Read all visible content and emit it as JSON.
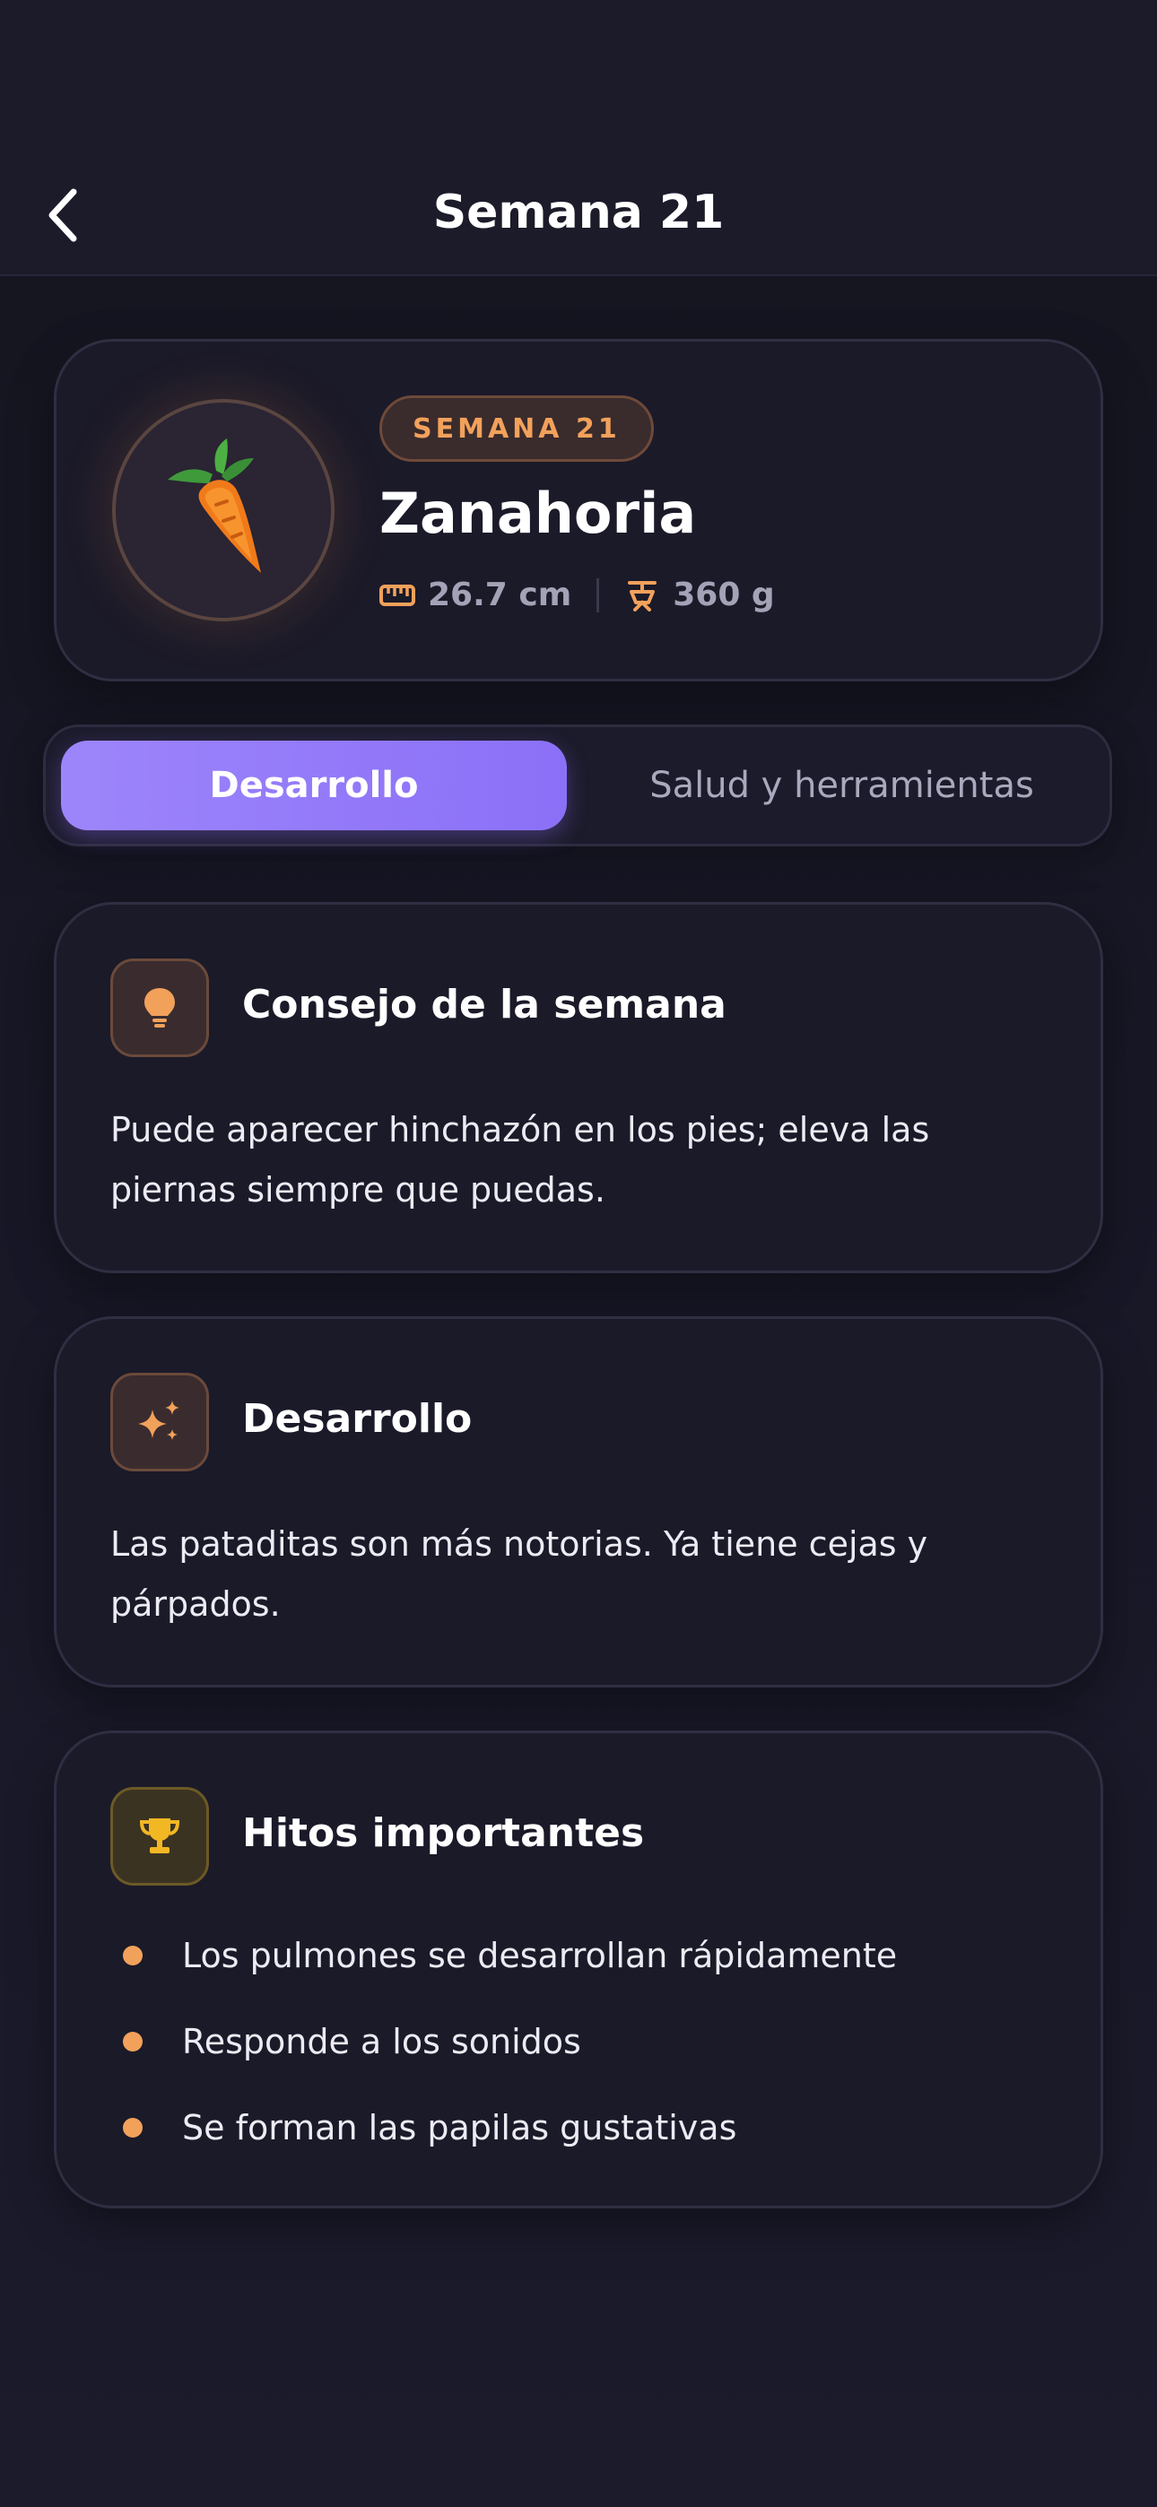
{
  "header": {
    "title": "Semana 21",
    "back_icon": "chevron-left-icon"
  },
  "hero": {
    "badge": "SEMANA 21",
    "fruit_name": "Zanahoria",
    "fruit_icon": "carrot-icon",
    "length": "26.7 cm",
    "length_icon": "ruler-icon",
    "weight": "360 g",
    "weight_icon": "scale-icon"
  },
  "tabs": [
    {
      "label": "Desarrollo",
      "active": true
    },
    {
      "label": "Salud y herramientas",
      "active": false
    }
  ],
  "tip": {
    "icon": "lightbulb-icon",
    "title": "Consejo de la semana",
    "body": "Puede aparecer hinchazón en los pies; eleva las piernas siempre que puedas."
  },
  "development": {
    "icon": "sparkles-icon",
    "title": "Desarrollo",
    "body": "Las pataditas son más notorias. Ya tiene cejas y párpados."
  },
  "milestones": {
    "icon": "trophy-icon",
    "title": "Hitos importantes",
    "items": [
      "Los pulmones se desarrollan rápidamente",
      "Responde a los sonidos",
      "Se forman las papilas gustativas"
    ]
  },
  "colors": {
    "accent_purple": "#8b70f7",
    "accent_orange": "#f2a15b",
    "accent_gold": "#f2b824",
    "background": "#171726",
    "card": "#1b1a29"
  }
}
